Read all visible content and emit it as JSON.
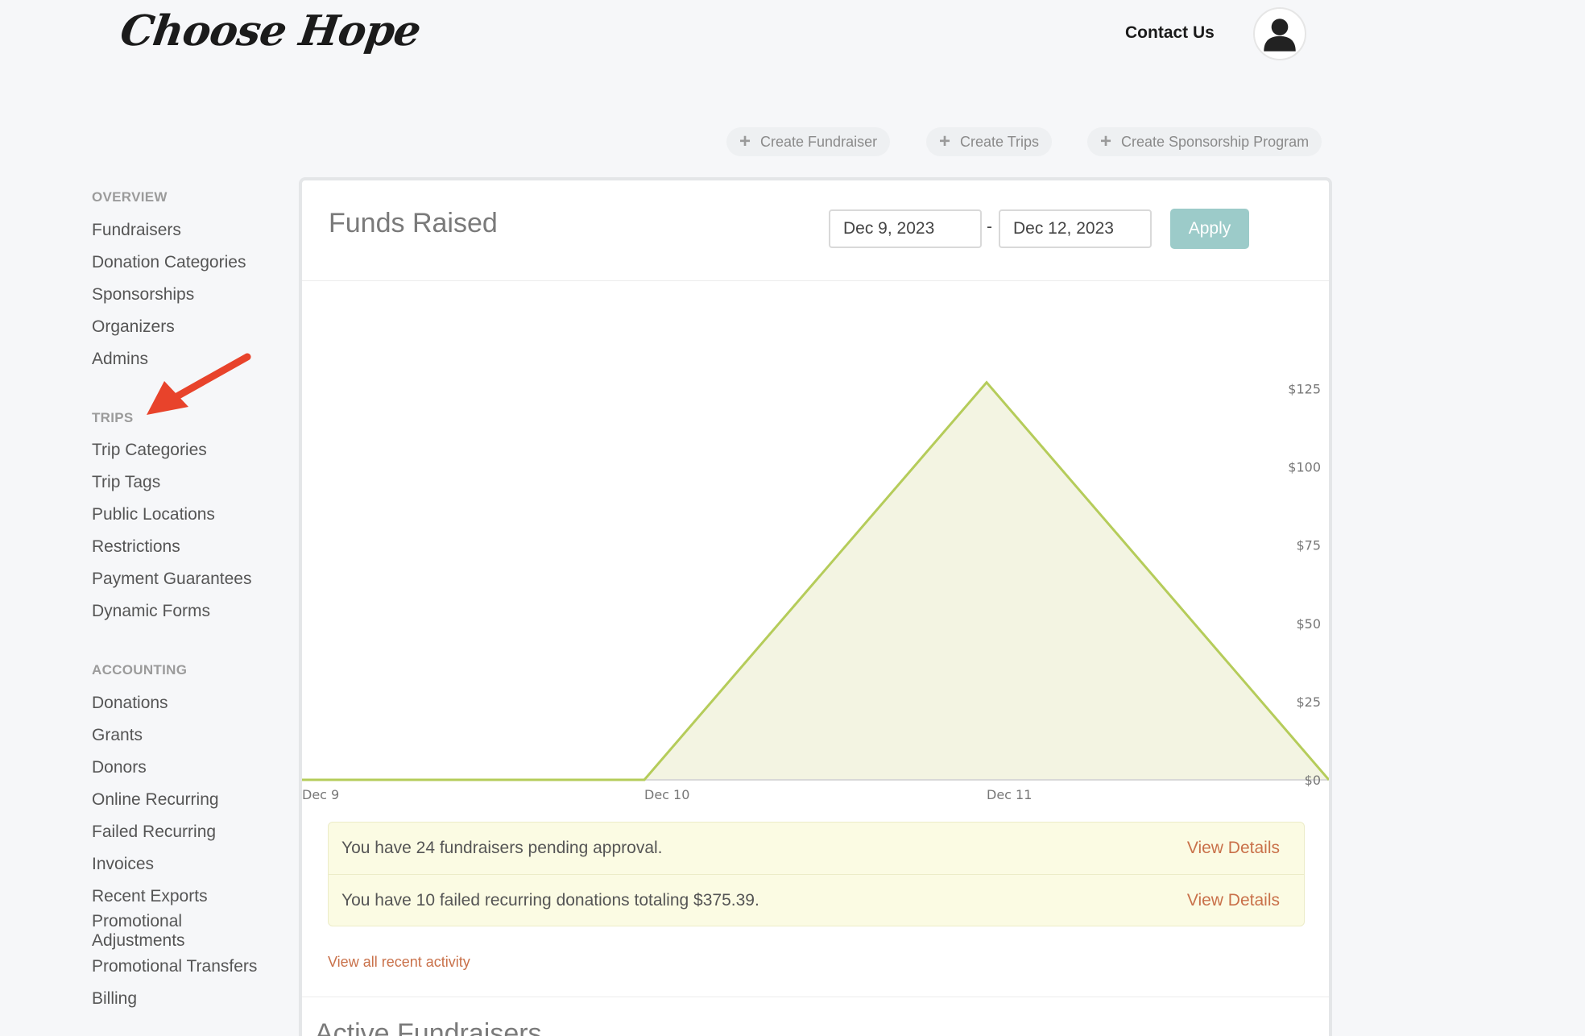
{
  "header": {
    "logo": "Choose Hope",
    "contact_label": "Contact Us"
  },
  "create_actions": {
    "fundraiser": "Create Fundraiser",
    "trips": "Create Trips",
    "sponsorship": "Create Sponsorship Program"
  },
  "sidebar": {
    "overview": {
      "title": "OVERVIEW",
      "items": [
        "Fundraisers",
        "Donation Categories",
        "Sponsorships",
        "Organizers",
        "Admins"
      ]
    },
    "trips": {
      "title": "TRIPS",
      "items": [
        "Trip Categories",
        "Trip Tags",
        "Public Locations",
        "Restrictions",
        "Payment Guarantees",
        "Dynamic Forms"
      ]
    },
    "accounting": {
      "title": "ACCOUNTING",
      "items": [
        "Donations",
        "Grants",
        "Donors",
        "Online Recurring",
        "Failed Recurring",
        "Invoices",
        "Recent Exports",
        "Promotional Adjustments",
        "Promotional Transfers",
        "Billing"
      ]
    }
  },
  "panel": {
    "title": "Funds Raised",
    "date_from": "Dec 9, 2023",
    "date_separator": "-",
    "date_to": "Dec 12, 2023",
    "apply_label": "Apply"
  },
  "chart_data": {
    "type": "area",
    "title": "",
    "xlabel": "",
    "ylabel": "",
    "x": [
      "Dec 9",
      "Dec 10",
      "Dec 11",
      "Dec 12"
    ],
    "x_tick_labels": [
      "Dec 9",
      "Dec 10",
      "Dec 11"
    ],
    "values": [
      0,
      0,
      127,
      0
    ],
    "y_ticks": [
      "$125",
      "$100",
      "$75",
      "$50",
      "$25",
      "$0"
    ],
    "y_tick_values": [
      125,
      100,
      75,
      50,
      25,
      0
    ],
    "ylim": [
      0,
      130
    ],
    "grid": false,
    "legend": "none",
    "line_color": "#b5cc5a",
    "fill_color": "#f3f4e2"
  },
  "alerts": [
    {
      "message": "You have 24 fundraisers pending approval.",
      "link": "View Details"
    },
    {
      "message": "You have 10 failed recurring donations totaling $375.39.",
      "link": "View Details"
    }
  ],
  "recent_activity_label": "View all recent activity",
  "active_fundraisers_title": "Active Fundraisers"
}
